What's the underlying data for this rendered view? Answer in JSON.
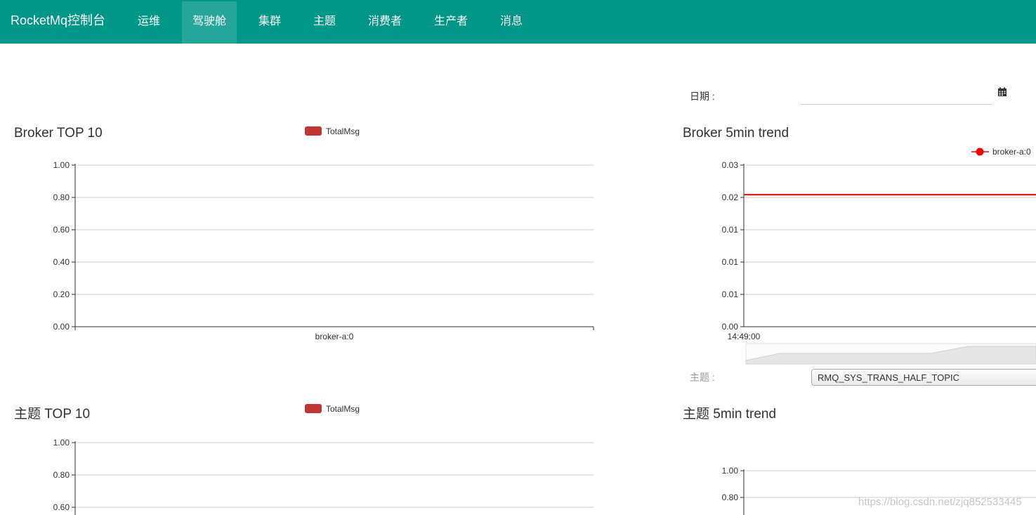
{
  "navbar": {
    "brand": "RocketMq控制台",
    "items": [
      {
        "label": "运维"
      },
      {
        "label": "驾驶舱"
      },
      {
        "label": "集群"
      },
      {
        "label": "主题"
      },
      {
        "label": "消费者"
      },
      {
        "label": "生产者"
      },
      {
        "label": "消息"
      }
    ],
    "active_index": 1,
    "color": "#009688"
  },
  "filters": {
    "date_label": "日期 :",
    "date_value": "",
    "calendar_icon": "calendar-icon"
  },
  "panels": {
    "broker_top10": {
      "title": "Broker TOP 10",
      "legend": "TotalMsg"
    },
    "broker_trend": {
      "title": "Broker 5min trend",
      "legend": "broker-a:0"
    },
    "topic_top10": {
      "title": "主题 TOP 10",
      "legend": "TotalMsg"
    },
    "topic_trend": {
      "title": "主题 5min trend"
    }
  },
  "topic_filter": {
    "label": "主题 :",
    "selected": "RMQ_SYS_TRANS_HALF_TOPIC"
  },
  "watermark": "https://blog.csdn.net/zjq852533445",
  "chart_data": [
    {
      "type": "bar",
      "title": "Broker TOP 10",
      "categories": [
        "broker-a:0"
      ],
      "series": [
        {
          "name": "TotalMsg",
          "values": [
            0
          ]
        }
      ],
      "ylim": [
        0,
        1
      ],
      "y_ticks": [
        "0.00",
        "0.20",
        "0.40",
        "0.60",
        "0.80",
        "1.00"
      ],
      "grid": true,
      "legend": "top-center",
      "color": "#c23531"
    },
    {
      "type": "line",
      "title": "Broker 5min trend",
      "x": [
        "14:49:00"
      ],
      "series": [
        {
          "name": "broker-a:0",
          "values": [
            0.0245
          ]
        }
      ],
      "ylim": [
        0,
        0.03
      ],
      "y_ticks": [
        "0.00",
        "0.01",
        "0.01",
        "0.01",
        "0.02",
        "0.03"
      ],
      "grid": true,
      "legend": "top-right",
      "color": "#ff0000"
    },
    {
      "type": "bar",
      "title": "主题 TOP 10",
      "categories": [],
      "series": [
        {
          "name": "TotalMsg",
          "values": []
        }
      ],
      "ylim": [
        0,
        1
      ],
      "y_ticks": [
        "0.60",
        "0.80",
        "1.00"
      ],
      "grid": true,
      "legend": "top-center",
      "color": "#c23531"
    },
    {
      "type": "line",
      "title": "主题 5min trend",
      "x": [],
      "series": [],
      "ylim": [
        0,
        1
      ],
      "y_ticks": [
        "0.80",
        "1.00"
      ],
      "grid": true
    }
  ]
}
